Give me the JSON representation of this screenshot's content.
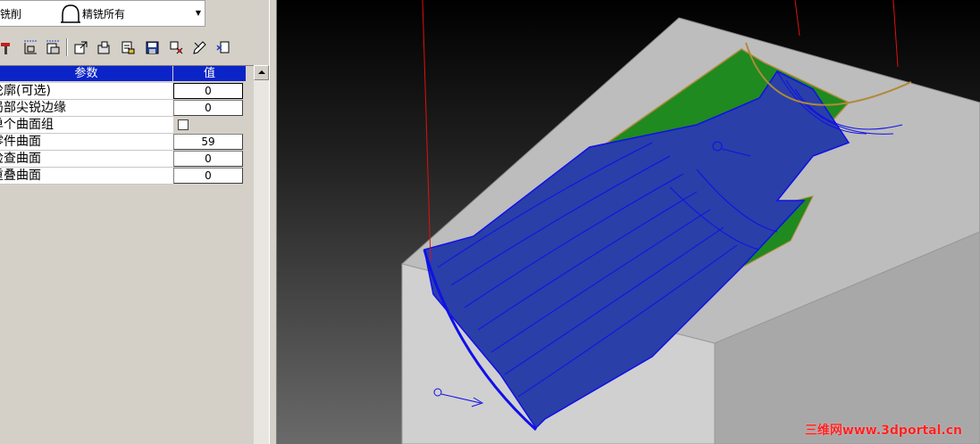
{
  "toolbar_top": {
    "operation_combo": "铣削",
    "strategy_combo": "精铣所有"
  },
  "toolbar_icons": [
    "tool-icon",
    "contour-icon",
    "surface-icon",
    "export-icon",
    "import-icon",
    "report-icon",
    "save-icon",
    "settings-icon",
    "edit-icon",
    "delete-icon"
  ],
  "param_grid": {
    "header_param": "参数",
    "header_value": "值",
    "rows": [
      {
        "name": "轮廓(可选)",
        "value": "0"
      },
      {
        "name": "局部尖锐边缘",
        "value": "0"
      },
      {
        "name": "单个曲面组",
        "value": ""
      },
      {
        "name": "零件曲面",
        "value": "59"
      },
      {
        "name": "检查曲面",
        "value": "0"
      },
      {
        "name": "重叠曲面",
        "value": "0"
      }
    ]
  },
  "viewport": {
    "watermark": "三维网www.3dportal.cn",
    "colors": {
      "stock": "#bdbdbd",
      "face_green": "#1f8a1f",
      "toolpath_blue": "#1010e8",
      "edge_tan": "#b08a3a",
      "tool_line": "#e01010"
    }
  }
}
